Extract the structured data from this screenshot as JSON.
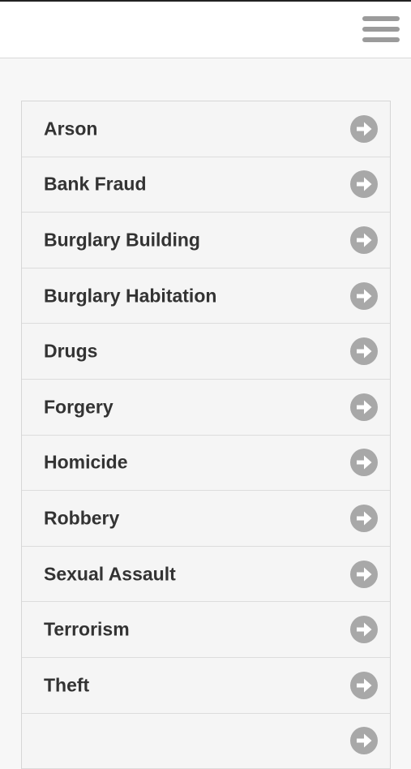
{
  "header": {
    "menu_icon": "hamburger-menu-icon"
  },
  "list": {
    "item_icon": "arrow-right-circle-icon",
    "items": [
      {
        "label": "Arson"
      },
      {
        "label": "Bank Fraud"
      },
      {
        "label": "Burglary Building"
      },
      {
        "label": "Burglary Habitation"
      },
      {
        "label": "Drugs"
      },
      {
        "label": "Forgery"
      },
      {
        "label": "Homicide"
      },
      {
        "label": "Robbery"
      },
      {
        "label": "Sexual Assault"
      },
      {
        "label": "Terrorism"
      },
      {
        "label": "Theft"
      },
      {
        "label": ""
      }
    ]
  },
  "colors": {
    "icon_gray": "#a8a8a8",
    "text": "#333333",
    "row_bg": "#f5f5f5",
    "page_bg": "#f7f7f7"
  }
}
